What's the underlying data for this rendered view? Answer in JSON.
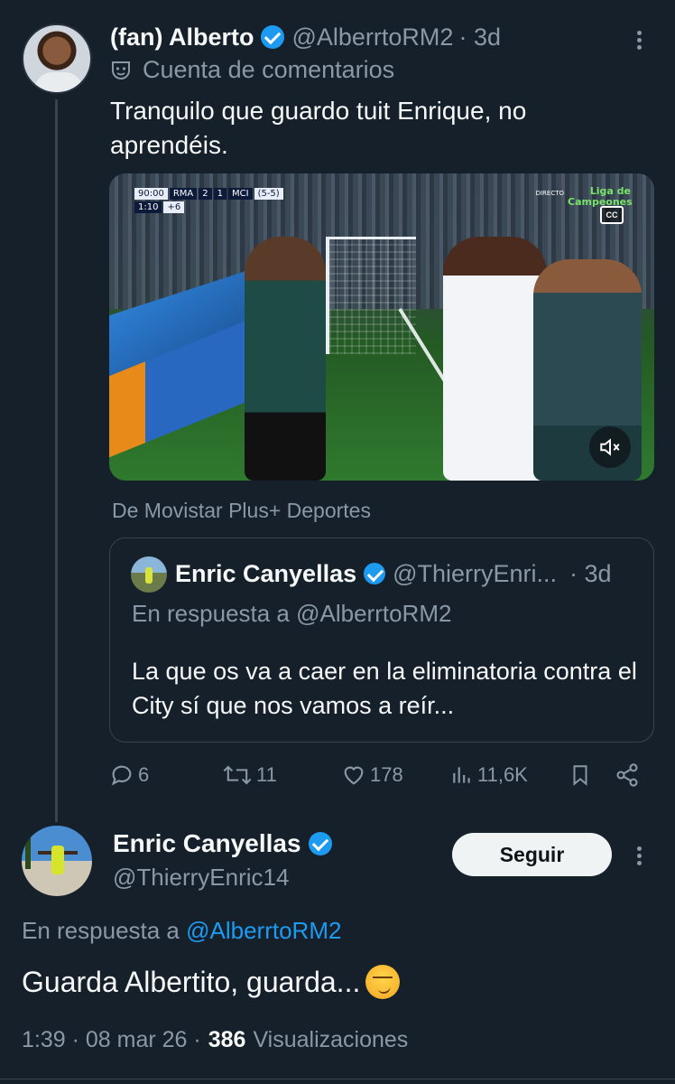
{
  "tweet1": {
    "display_name": "(fan) Alberto",
    "handle": "@AlberrtoRM2",
    "time": "· 3d",
    "label": "Cuenta de comentarios",
    "text": "Tranquilo que guardo tuit Enrique, no aprendéis.",
    "video": {
      "scorebug_time": "90:00",
      "home": "RMA",
      "home_score": "2",
      "away_score": "1",
      "away": "MCI",
      "aggregate": "(5-5)",
      "added_time": "1:10",
      "added": "+6",
      "live": "DIRECTO",
      "competition": "Liga de Campeones",
      "cc": "CC"
    },
    "source": "De Movistar Plus+ Deportes",
    "quote": {
      "display_name": "Enric Canyellas",
      "handle": "@ThierryEnri...",
      "time": "· 3d",
      "reply_to": "En respuesta a @AlberrtoRM2",
      "text": "La que os va a caer en la eliminatoria contra el City sí que nos vamos a reír..."
    },
    "actions": {
      "replies": "6",
      "retweets": "11",
      "likes": "178",
      "views": "11,6K"
    }
  },
  "tweet2": {
    "display_name": "Enric Canyellas",
    "handle": "@ThierryEnric14",
    "follow_label": "Seguir",
    "reply_prefix": "En respuesta a",
    "reply_handle": "@AlberrtoRM2",
    "text": "Guarda Albertito, guarda...",
    "time": "1:39 · 08 mar 26 ·",
    "views_count": "386",
    "views_label": "Visualizaciones"
  },
  "colors": {
    "background": "#15202b",
    "accent": "#1d9bf0",
    "muted": "#8b98a5"
  }
}
